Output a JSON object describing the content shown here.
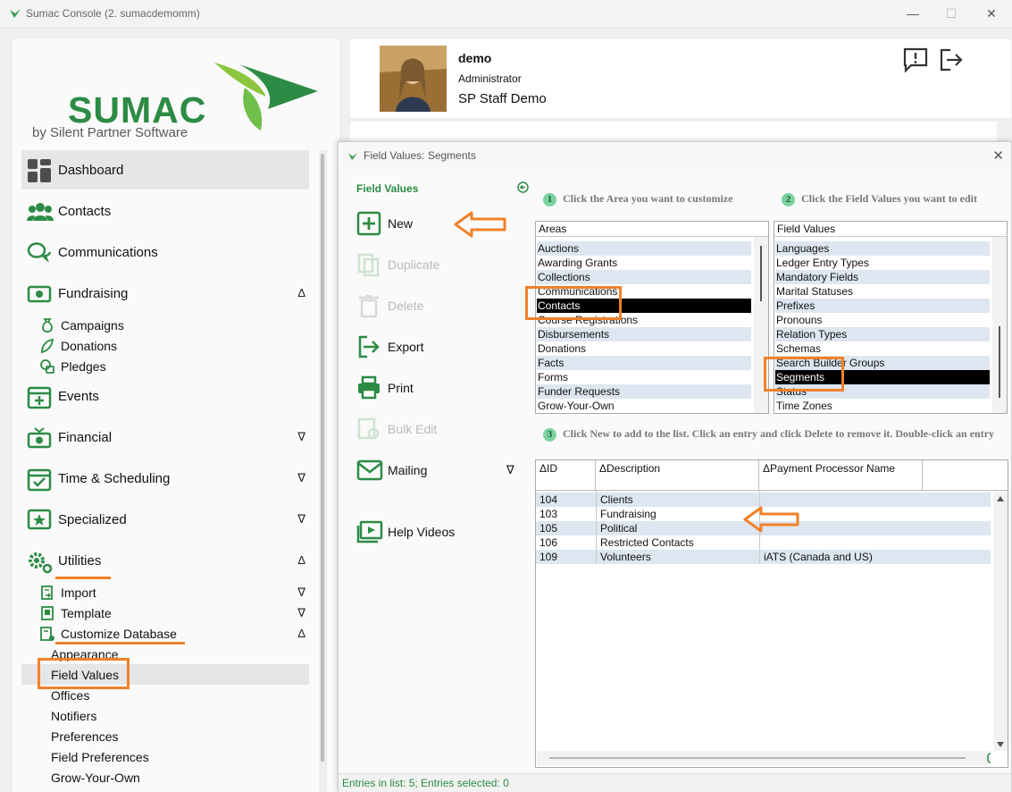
{
  "window": {
    "title": "Sumac Console (2. sumacdemomm)",
    "minimize": "—",
    "maximize": "☐",
    "close": "✕"
  },
  "brand": {
    "name": "SUMAC",
    "tagline": "by Silent Partner Software"
  },
  "nav": {
    "dashboard": "Dashboard",
    "contacts": "Contacts",
    "communications": "Communications",
    "fundraising": "Fundraising",
    "campaigns": "Campaigns",
    "donations": "Donations",
    "pledges": "Pledges",
    "events": "Events",
    "financial": "Financial",
    "time_scheduling": "Time & Scheduling",
    "specialized": "Specialized",
    "utilities": "Utilities",
    "import": "Import",
    "template": "Template",
    "customize_database": "Customize Database",
    "appearance": "Appearance",
    "field_values": "Field Values",
    "offices": "Offices",
    "notifiers": "Notifiers",
    "preferences": "Preferences",
    "field_preferences": "Field Preferences",
    "grow_your_own": "Grow-Your-Own",
    "arrow_up": "Δ",
    "arrow_down": "∇"
  },
  "user": {
    "name": "demo",
    "role": "Administrator",
    "staff": "SP Staff Demo"
  },
  "dialog": {
    "title": "Field Values: Segments",
    "close": "✕",
    "actions_title": "Field Values",
    "actions": {
      "new": "New",
      "duplicate": "Duplicate",
      "delete": "Delete",
      "export": "Export",
      "print": "Print",
      "bulk_edit": "Bulk Edit",
      "mailing": "Mailing",
      "mailing_arrow": "∇",
      "help_videos": "Help Videos"
    },
    "step1": {
      "num": "1",
      "text": "Click the Area you want to customize"
    },
    "step2": {
      "num": "2",
      "text": "Click the Field Values you want to edit"
    },
    "step3": {
      "num": "3",
      "text": "Click New to add to the list. Click an entry and click Delete to remove it. Double-click an entry"
    },
    "areas": {
      "header": "Areas",
      "items": [
        "Auctions",
        "Awarding Grants",
        "Collections",
        "Communications",
        "Contacts",
        "Course Registrations",
        "Disbursements",
        "Donations",
        "Facts",
        "Forms",
        "Funder Requests",
        "Grow-Your-Own"
      ],
      "selected": "Contacts"
    },
    "field_values": {
      "header": "Field Values",
      "items": [
        "Languages",
        "Ledger Entry Types",
        "Mandatory Fields",
        "Marital Statuses",
        "Prefixes",
        "Pronouns",
        "Relation Types",
        "Schemas",
        "Search Builder Groups",
        "Segments",
        "Status",
        "Time Zones"
      ],
      "selected": "Segments"
    },
    "grid": {
      "columns": [
        "ID",
        "Description",
        "Payment Processor Name"
      ],
      "sort_marker": "Δ",
      "rows": [
        {
          "id": "104",
          "description": "Clients",
          "processor": ""
        },
        {
          "id": "103",
          "description": "Fundraising",
          "processor": ""
        },
        {
          "id": "105",
          "description": "Political",
          "processor": ""
        },
        {
          "id": "106",
          "description": "Restricted Contacts",
          "processor": ""
        },
        {
          "id": "109",
          "description": "Volunteers",
          "processor": "iATS (Canada and US)"
        }
      ]
    },
    "status": "Entries in list: 5; Entries selected: 0"
  }
}
